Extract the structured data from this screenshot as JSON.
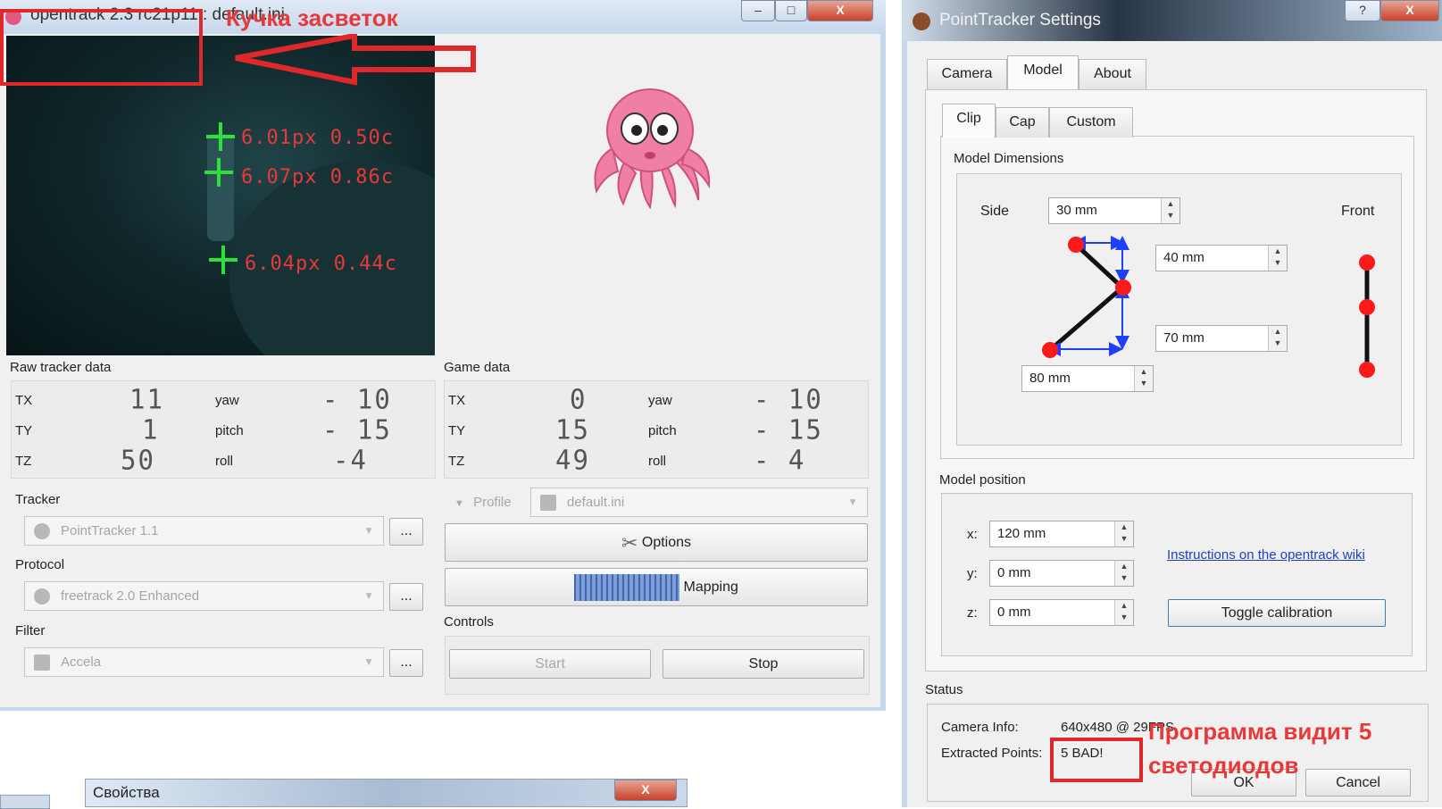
{
  "main_window": {
    "title": "opentrack 2.3 rc21p11 : default.ini",
    "annotation": "Кучка засветок",
    "controls": {
      "minimize": "–",
      "maximize": "□",
      "close": "X"
    },
    "points": [
      {
        "label": "6.01px 0.50c"
      },
      {
        "label": "6.07px 0.86c"
      },
      {
        "label": "6.04px 0.44c"
      }
    ],
    "raw_tracker_data": {
      "title": "Raw tracker data",
      "rows": [
        {
          "axis": "TX",
          "axis_value": "11",
          "rot": "yaw",
          "rot_value": "- 10"
        },
        {
          "axis": "TY",
          "axis_value": "1",
          "rot": "pitch",
          "rot_value": "- 15"
        },
        {
          "axis": "TZ",
          "axis_value": "50",
          "rot": "roll",
          "rot_value": "-4"
        }
      ]
    },
    "game_data": {
      "title": "Game data",
      "rows": [
        {
          "axis": "TX",
          "axis_value": "0",
          "rot": "yaw",
          "rot_value": "- 10"
        },
        {
          "axis": "TY",
          "axis_value": "15",
          "rot": "pitch",
          "rot_value": "- 15"
        },
        {
          "axis": "TZ",
          "axis_value": "49",
          "rot": "roll",
          "rot_value": "- 4"
        }
      ]
    },
    "tracker": {
      "label": "Tracker",
      "value": "PointTracker 1.1",
      "more": "..."
    },
    "protocol": {
      "label": "Protocol",
      "value": "freetrack 2.0 Enhanced",
      "more": "..."
    },
    "filter": {
      "label": "Filter",
      "value": "Accela",
      "more": "..."
    },
    "profile": {
      "label": "Profile",
      "value": "default.ini"
    },
    "options_button": "Options",
    "mapping_button": "Mapping",
    "controls_label": "Controls",
    "start_button": "Start",
    "stop_button": "Stop"
  },
  "settings_window": {
    "title": "PointTracker Settings",
    "help": "?",
    "close": "X",
    "tabs": [
      "Camera",
      "Model",
      "About"
    ],
    "subtabs": [
      "Clip",
      "Cap",
      "Custom"
    ],
    "model_dimensions": {
      "title": "Model Dimensions",
      "side_label": "Side",
      "front_label": "Front",
      "side_value": "30 mm",
      "top_value": "40 mm",
      "bottom_value": "70 mm",
      "depth_value": "80 mm"
    },
    "model_position": {
      "title": "Model position",
      "x_label": "x:",
      "x_value": "120 mm",
      "y_label": "y:",
      "y_value": "0 mm",
      "z_label": "z:",
      "z_value": "0 mm",
      "wiki_link": "Instructions on the opentrack wiki",
      "toggle_calibration": "Toggle calibration"
    },
    "status": {
      "title": "Status",
      "camera_info_label": "Camera Info:",
      "camera_info_value": "640x480 @ 29FPS",
      "extracted_points_label": "Extracted Points:",
      "extracted_points_value": "5 BAD!",
      "annotation_line1": "Программа видит 5",
      "annotation_line2": "светодиодов"
    },
    "ok_button": "OK",
    "cancel_button": "Cancel"
  },
  "properties_window": {
    "title": "Свойства",
    "close": "X"
  },
  "colors": {
    "annotation_red": "#e0272a",
    "point_green": "#2ee03a",
    "led_red": "#ff1a1a",
    "link_blue": "#1f3fbf"
  }
}
